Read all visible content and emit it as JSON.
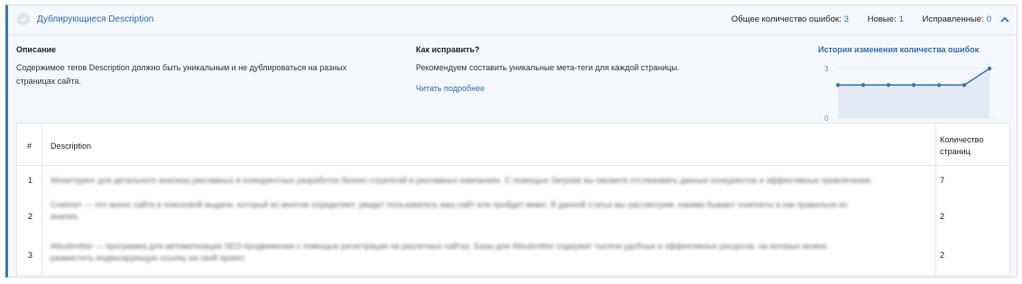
{
  "header": {
    "title": "Дублирующиеся Description",
    "total_label": "Общее количество ошибок:",
    "total_value": "3",
    "new_label": "Новые:",
    "new_value": "1",
    "fixed_label": "Исправленные:",
    "fixed_value": "0"
  },
  "description": {
    "title": "Описание",
    "line1": "Содержимое тегов Description должно быть уникальным и не дублироваться на разных",
    "line2": "страницах сайта."
  },
  "fix": {
    "title": "Как исправить?",
    "text": "Рекомендуем составить уникальные мета-теги для каждой страницы.",
    "read_more": "Читать подробнее"
  },
  "chart_data": {
    "type": "area",
    "title": "История изменения количества ошибок",
    "y_ticks": [
      "3",
      "0"
    ],
    "ylim": [
      0,
      3
    ],
    "values": [
      2,
      2,
      2,
      2,
      2,
      2,
      3
    ],
    "color": "#3f74b5",
    "fill": "#e2eaf6"
  },
  "table": {
    "col_num": "#",
    "col_desc": "Description",
    "col_count_1": "Количество",
    "col_count_2": "страниц",
    "rows": [
      {
        "num": "1",
        "line1": "Мониторинг для детального анализа рекламных и конкурентных разработок бизнес-стратегий в рекламных кампаниях. С помощью Serpstat вы сможете отслеживать данные конкурентов и эффективные привлечения.",
        "line2": "",
        "count": "7"
      },
      {
        "num": "2",
        "line1": "Сниппет — это анонс сайта в поисковой выдаче, который во многом определяет, увидит пользователь ваш сайт или пройдет мимо. В данной статье мы рассмотрим, какими бывают сниппеты и как правильно их",
        "line2": "анализ.",
        "count": "2"
      },
      {
        "num": "3",
        "line1": "Allsubmitter — программа для автоматизации SEO-продвижения с помощью регистрации на различных сайтах. Базы для Allsubmitter содержат тысячи удобных и эффективных ресурсов, на которых можно",
        "line2": "разместить индексирующую ссылку на свой проект.",
        "count": "2"
      }
    ]
  }
}
